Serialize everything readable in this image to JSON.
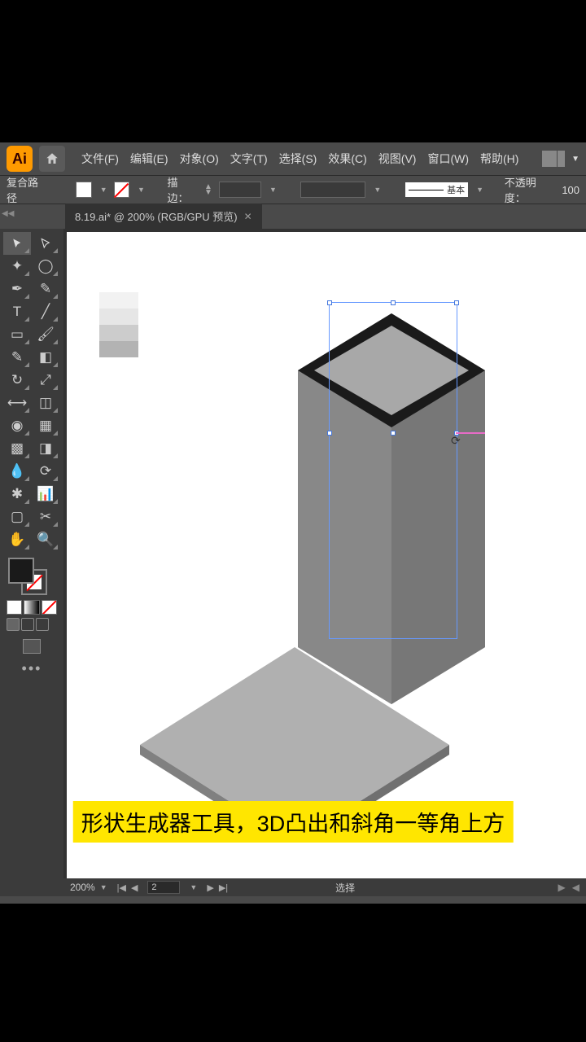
{
  "menubar": {
    "file": "文件(F)",
    "edit": "编辑(E)",
    "object": "对象(O)",
    "text": "文字(T)",
    "select": "选择(S)",
    "effect": "效果(C)",
    "view": "视图(V)",
    "window": "窗口(W)",
    "help": "帮助(H)"
  },
  "options": {
    "selection_type": "复合路径",
    "stroke_label": "描边：",
    "stroke_weight": "",
    "profile_text": "基本",
    "opacity_label": "不透明度：",
    "opacity_value": "100"
  },
  "document": {
    "tab_title": "8.19.ai* @ 200% (RGB/GPU 预览)"
  },
  "swatches": {
    "c1": "#f2f2f2",
    "c2": "#e6e6e6",
    "c3": "#cccccc",
    "c4": "#b3b3b3"
  },
  "statusbar": {
    "zoom": "200%",
    "artboard_num": "2",
    "tool": "选择"
  },
  "subtitle": "形状生成器工具，3D凸出和斜角一等角上方",
  "chart_data": null
}
